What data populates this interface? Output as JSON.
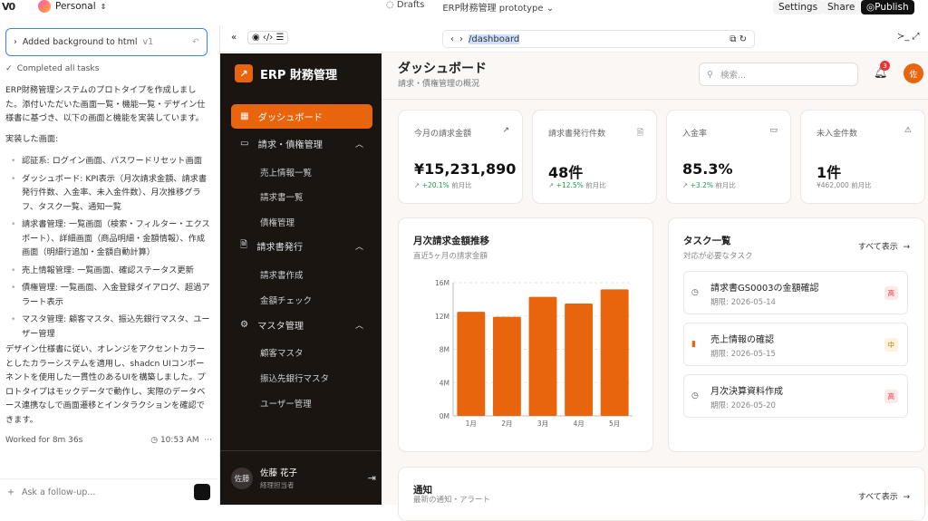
{
  "topbar": {
    "logo": "V0",
    "workspace": "Personal",
    "drafts": "Drafts",
    "project": "ERP財務管理 prototype",
    "settings": "Settings",
    "share": "Share",
    "publish": "Publish"
  },
  "chat": {
    "message_title": "Added background to html",
    "message_version": "v1",
    "completed": "Completed all tasks",
    "intro": "ERP財務管理システムのプロトタイプを作成しました。添付いただいた画面一覧・機能一覧・デザイン仕様書に基づき、以下の画面と機能を実装しています。",
    "impl_heading": "実装した画面:",
    "bullets": [
      "認証系: ログイン画面、パスワードリセット画面",
      "ダッシュボード: KPI表示（月次請求金額、請求書発行件数、入金率、未入金件数）、月次推移グラフ、タスク一覧、通知一覧",
      "請求書管理: 一覧画面（検索・フィルター・エクスポート）、詳細画面（商品明細・金額情報）、作成画面（明細行追加・金額自動計算）",
      "売上情報管理: 一覧画面、確認ステータス更新",
      "債権管理: 一覧画面、入金登録ダイアログ、超過アラート表示",
      "マスタ管理: 顧客マスタ、振込先銀行マスタ、ユーザー管理"
    ],
    "outro": "デザイン仕様書に従い、オレンジをアクセントカラーとしたカラーシステムを適用し、shadcn UIコンポーネントを使用した一貫性のあるUIを構築しました。プロトタイプはモックデータで動作し、実際のデータベース連携なしで画面遷移とインタラクションを確認できます。",
    "worked": "Worked for 8m 36s",
    "time": "10:53 AM",
    "followup_placeholder": "Ask a follow-up..."
  },
  "preview": {
    "url": "/dashboard"
  },
  "sidebar": {
    "brand": "ERP 財務管理",
    "nav": [
      {
        "label": "ダッシュボード"
      },
      {
        "label": "請求・債権管理"
      },
      {
        "label": "請求書発行"
      },
      {
        "label": "マスタ管理"
      }
    ],
    "sub1": [
      "売上情報一覧",
      "請求書一覧",
      "債権管理"
    ],
    "sub2": [
      "請求書作成",
      "金額チェック"
    ],
    "sub3": [
      "顧客マスタ",
      "振込先銀行マスタ",
      "ユーザー管理"
    ],
    "user_initial": "佐藤",
    "user_name": "佐藤 花子",
    "user_role": "経理担当者"
  },
  "header": {
    "title": "ダッシュボード",
    "subtitle": "請求・債権管理の概況",
    "search_placeholder": "検索...",
    "notif_count": "3",
    "avatar": "佐"
  },
  "kpis": [
    {
      "label": "今月の請求金額",
      "value": "¥15,231,890",
      "delta": "+20.1%",
      "period": "前月比"
    },
    {
      "label": "請求書発行件数",
      "value": "48件",
      "delta": "+12.5%",
      "period": "前月比"
    },
    {
      "label": "入金率",
      "value": "85.3%",
      "delta": "+3.2%",
      "period": "前月比"
    },
    {
      "label": "未入金件数",
      "value": "1件",
      "delta": "",
      "period": "¥462,000 前月比"
    }
  ],
  "chart": {
    "title": "月次請求金額推移",
    "subtitle": "直近5ヶ月の請求金額"
  },
  "chart_data": {
    "type": "bar",
    "categories": [
      "1月",
      "2月",
      "3月",
      "4月",
      "5月"
    ],
    "values": [
      12.5,
      11.9,
      14.3,
      13.5,
      15.2
    ],
    "ylim": [
      0,
      16
    ],
    "yticks": [
      "0M",
      "4M",
      "8M",
      "12M",
      "16M"
    ],
    "color": "#e8650e",
    "grid": true
  },
  "tasks": {
    "title": "タスク一覧",
    "subtitle": "対応が必要なタスク",
    "view_all": "すべて表示",
    "items": [
      {
        "title": "請求書GS0003の金額確認",
        "due": "期限: 2026-05-14",
        "priority": "高"
      },
      {
        "title": "売上情報の確認",
        "due": "期限: 2026-05-15",
        "priority": "中"
      },
      {
        "title": "月次決算資料作成",
        "due": "期限: 2026-05-20",
        "priority": "高"
      }
    ]
  },
  "notices": {
    "title": "通知",
    "subtitle": "最新の通知・アラート",
    "view_all": "すべて表示"
  }
}
